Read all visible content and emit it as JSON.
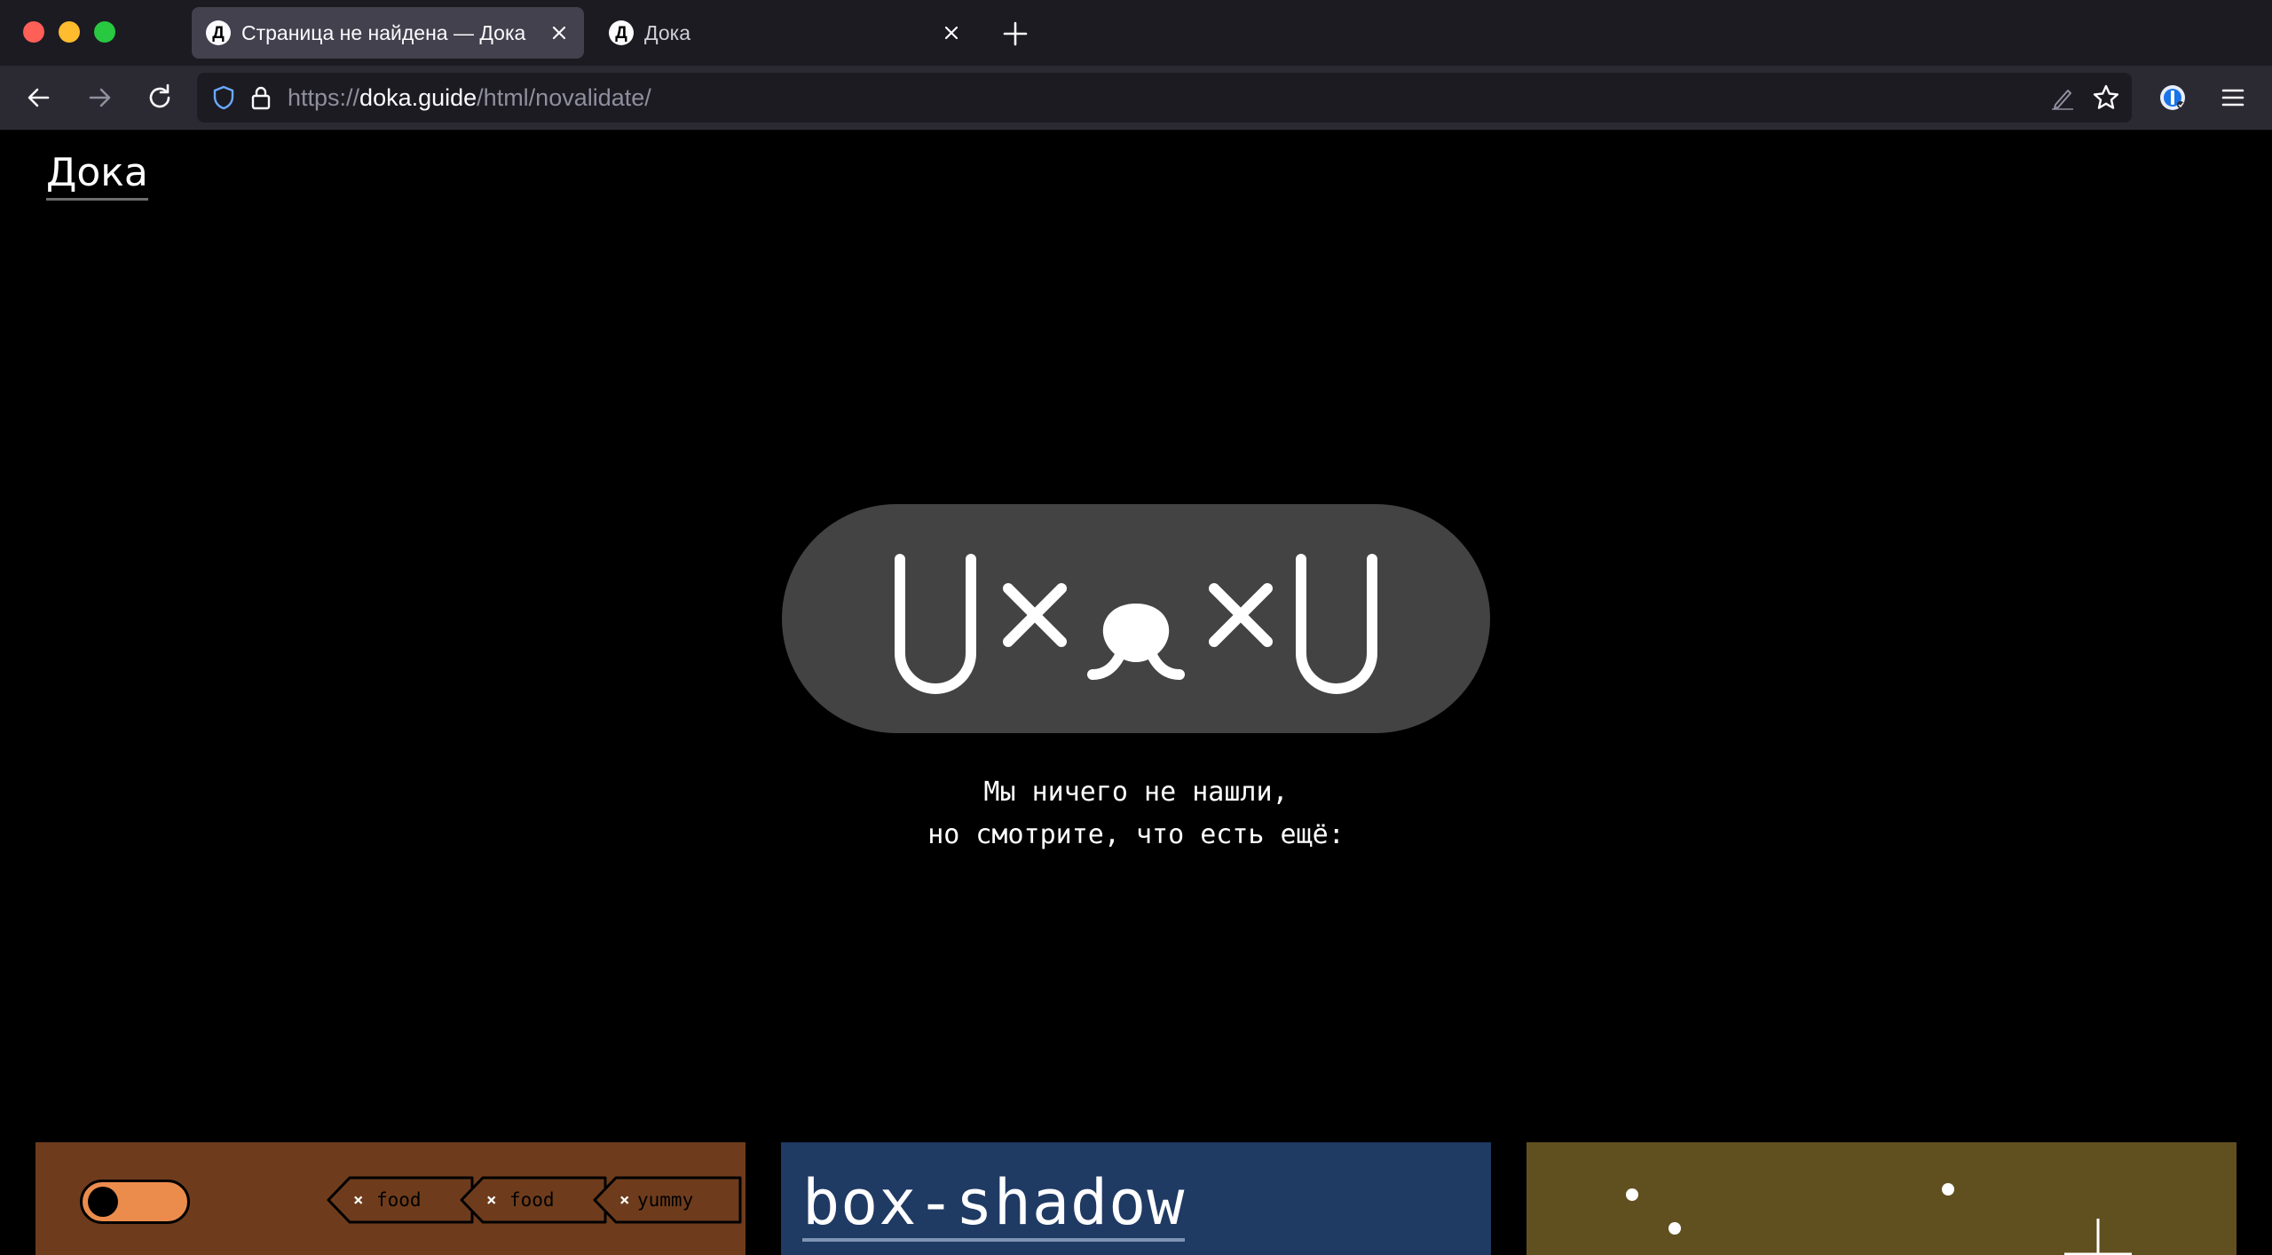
{
  "window": {
    "tabs": [
      {
        "title": "Страница не найдена — Дока",
        "favicon_letter": "Д",
        "active": true
      },
      {
        "title": "Дока",
        "favicon_letter": "Д",
        "active": false
      }
    ]
  },
  "navbar": {
    "url_scheme": "https://",
    "url_host": "doka.guide",
    "url_path": "/html/novalidate/"
  },
  "page": {
    "logo": "Дока",
    "error_face": "U×ᴥ×U",
    "message_line1": "Мы ничего не нашли,",
    "message_line2": "но смотрите, что есть ещё:",
    "cards": [
      {
        "color": "#6e3c1c",
        "tags": [
          "food",
          "food",
          "yummy"
        ],
        "tag_close": "×"
      },
      {
        "color": "#1f3a63",
        "title": "box-shadow"
      },
      {
        "color": "#605020"
      }
    ]
  },
  "colors": {
    "tabstrip": "#1c1b22",
    "toolbar": "#2b2a33",
    "accent_shield": "#3b82f6",
    "pill": "#434343"
  }
}
